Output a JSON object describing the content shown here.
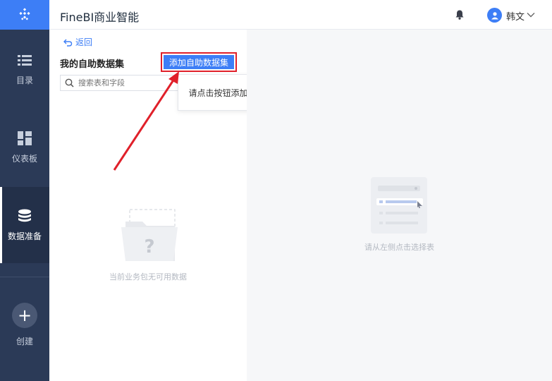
{
  "app": {
    "title": "FineBI商业智能"
  },
  "colors": {
    "accent": "#3d7ef6",
    "nav_bg": "#2b3a57",
    "highlight_red": "#e0202a"
  },
  "nav": {
    "items": [
      {
        "label": "目录",
        "icon": "list-icon"
      },
      {
        "label": "仪表板",
        "icon": "dashboard-icon"
      },
      {
        "label": "数据准备",
        "icon": "database-icon",
        "active": true
      },
      {
        "label": "创建",
        "icon": "plus-icon"
      }
    ]
  },
  "header": {
    "username": "韩文"
  },
  "panel": {
    "back_label": "返回",
    "title": "我的自助数据集",
    "add_button": "添加自助数据集",
    "search_placeholder": "搜索表和字段",
    "tooltip": "请点击按钮添加表",
    "empty_text": "当前业务包无可用数据"
  },
  "main": {
    "empty_text": "请从左侧点击选择表"
  }
}
